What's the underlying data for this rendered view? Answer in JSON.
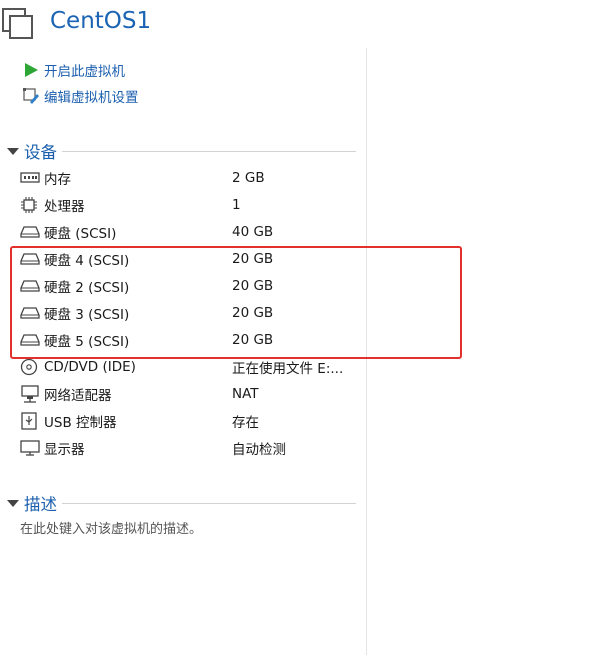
{
  "vm": {
    "title": "CentOS1"
  },
  "actions": [
    {
      "label": "开启此虚拟机",
      "icon": "play-icon"
    },
    {
      "label": "编辑虚拟机设置",
      "icon": "edit-settings-icon"
    }
  ],
  "devices_section": {
    "label": "设备"
  },
  "devices": [
    {
      "name": "内存",
      "value": "2 GB",
      "icon": "memory-icon"
    },
    {
      "name": "处理器",
      "value": "1",
      "icon": "processor-icon"
    },
    {
      "name": "硬盘 (SCSI)",
      "value": "40 GB",
      "icon": "hard-disk-icon"
    },
    {
      "name": "硬盘 4 (SCSI)",
      "value": "20 GB",
      "icon": "hard-disk-icon"
    },
    {
      "name": "硬盘 2 (SCSI)",
      "value": "20 GB",
      "icon": "hard-disk-icon"
    },
    {
      "name": "硬盘 3 (SCSI)",
      "value": "20 GB",
      "icon": "hard-disk-icon"
    },
    {
      "name": "硬盘 5 (SCSI)",
      "value": "20 GB",
      "icon": "hard-disk-icon"
    },
    {
      "name": "CD/DVD (IDE)",
      "value": "正在使用文件 E:...",
      "icon": "cd-dvd-icon"
    },
    {
      "name": "网络适配器",
      "value": "NAT",
      "icon": "network-adapter-icon"
    },
    {
      "name": "USB 控制器",
      "value": "存在",
      "icon": "usb-controller-icon"
    },
    {
      "name": "显示器",
      "value": "自动检测",
      "icon": "display-icon"
    }
  ],
  "description_section": {
    "label": "描述",
    "placeholder": "在此处键入对该虚拟机的描述。"
  },
  "colors": {
    "accent": "#1b5fae",
    "highlight_border": "#e2302c"
  }
}
